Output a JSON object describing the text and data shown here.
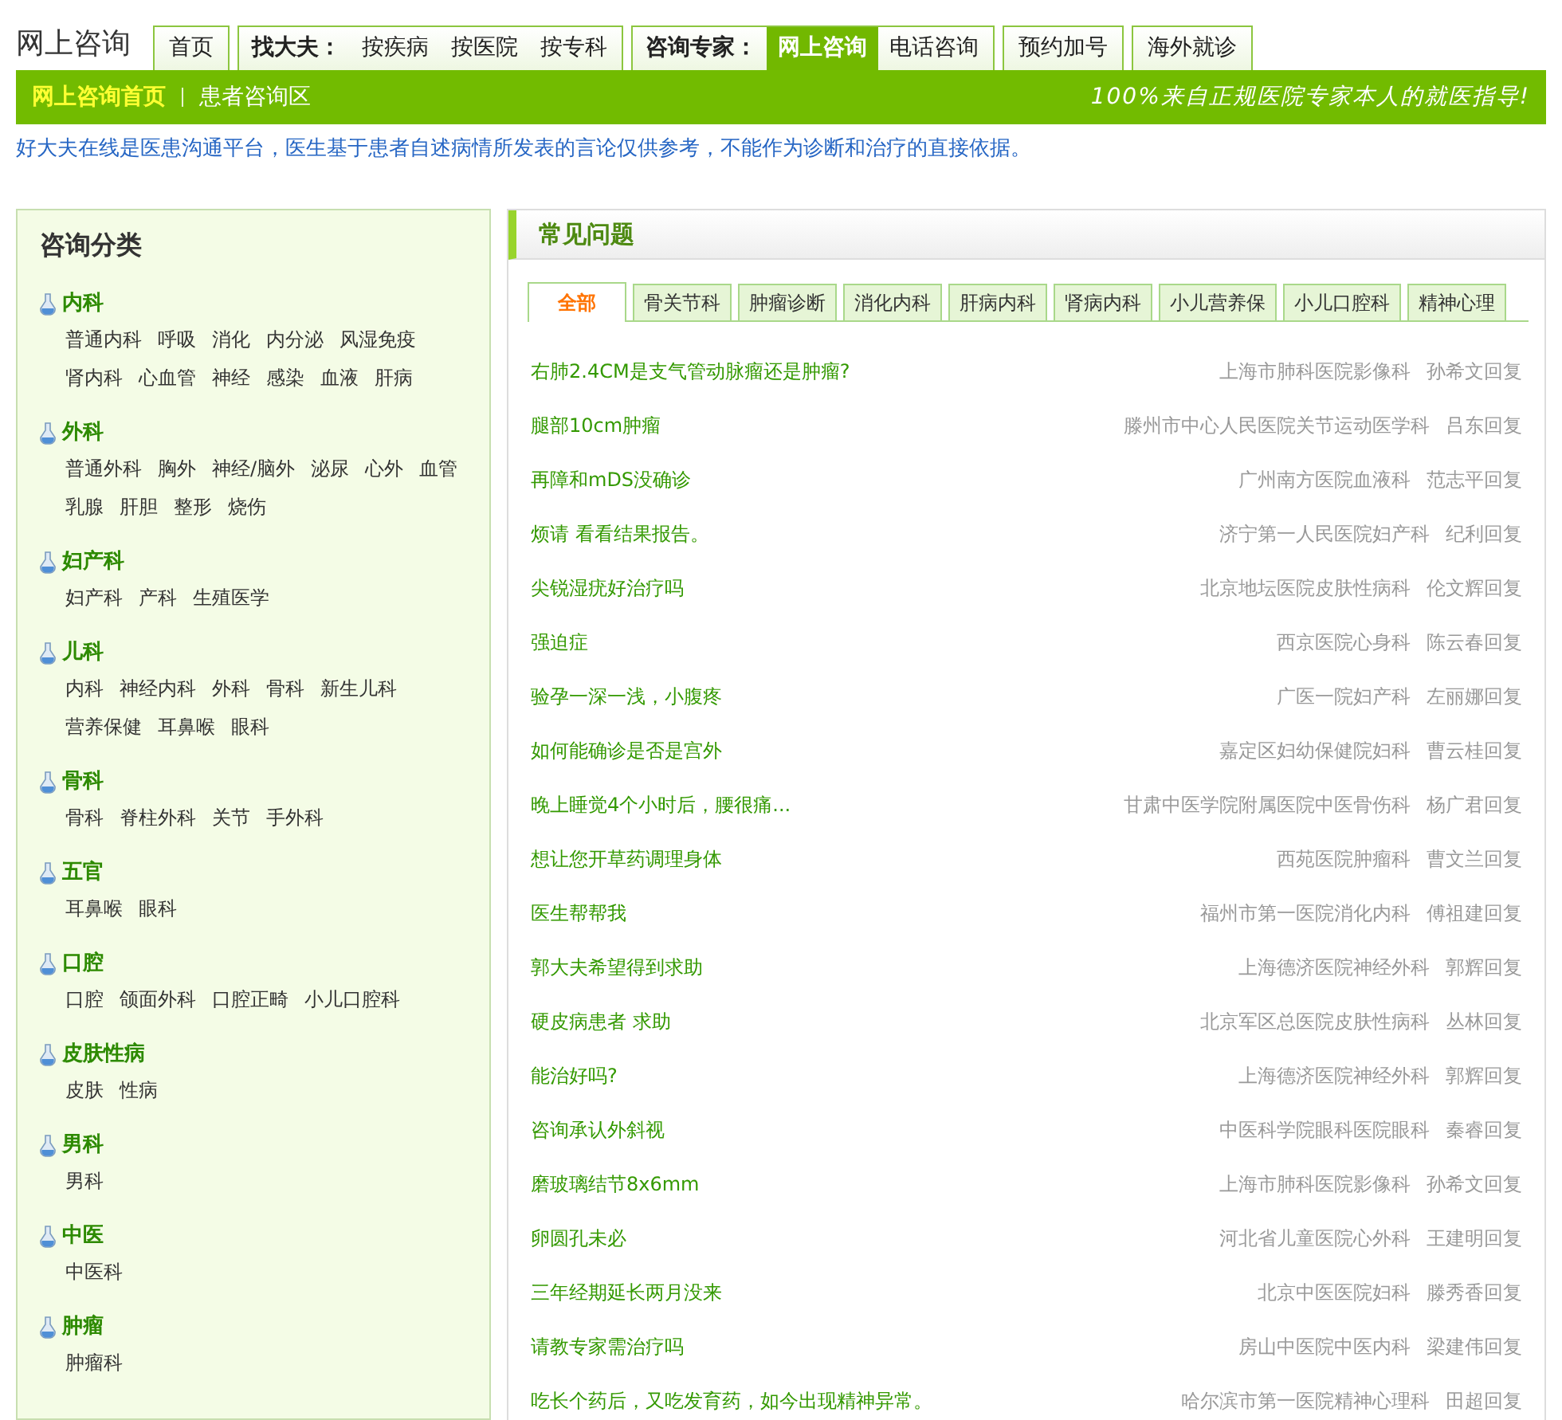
{
  "site_title": "网上咨询",
  "nav_groups": [
    {
      "items": [
        {
          "label": "首页",
          "selected": false
        }
      ]
    },
    {
      "label": "找大夫：",
      "items": [
        {
          "label": "按疾病",
          "selected": false
        },
        {
          "label": "按医院",
          "selected": false
        },
        {
          "label": "按专科",
          "selected": false
        }
      ]
    },
    {
      "label": "咨询专家：",
      "items": [
        {
          "label": "网上咨询",
          "selected": true
        },
        {
          "label": "电话咨询",
          "selected": false
        }
      ]
    },
    {
      "items": [
        {
          "label": "预约加号",
          "selected": false
        }
      ]
    },
    {
      "items": [
        {
          "label": "海外就诊",
          "selected": false
        }
      ]
    }
  ],
  "breadcrumb": [
    {
      "label": "网上咨询首页",
      "selected": true
    },
    {
      "label": "患者咨询区",
      "selected": false
    }
  ],
  "slogan": "100%来自正规医院专家本人的就医指导!",
  "disclaimer": "好大夫在线是医患沟通平台，医生基于患者自述病情所发表的言论仅供参考，不能作为诊断和治疗的直接依据。",
  "sidebar": {
    "title": "咨询分类",
    "categories": [
      {
        "name": "内科",
        "items": [
          "普通内科",
          "呼吸",
          "消化",
          "内分泌",
          "风湿免疫",
          "肾内科",
          "心血管",
          "神经",
          "感染",
          "血液",
          "肝病"
        ]
      },
      {
        "name": "外科",
        "items": [
          "普通外科",
          "胸外",
          "神经/脑外",
          "泌尿",
          "心外",
          "血管",
          "乳腺",
          "肝胆",
          "整形",
          "烧伤"
        ]
      },
      {
        "name": "妇产科",
        "items": [
          "妇产科",
          "产科",
          "生殖医学"
        ]
      },
      {
        "name": "儿科",
        "items": [
          "内科",
          "神经内科",
          "外科",
          "骨科",
          "新生儿科",
          "营养保健",
          "耳鼻喉",
          "眼科"
        ]
      },
      {
        "name": "骨科",
        "items": [
          "骨科",
          "脊柱外科",
          "关节",
          "手外科"
        ]
      },
      {
        "name": "五官",
        "items": [
          "耳鼻喉",
          "眼科"
        ]
      },
      {
        "name": "口腔",
        "items": [
          "口腔",
          "颌面外科",
          "口腔正畸",
          "小儿口腔科"
        ]
      },
      {
        "name": "皮肤性病",
        "items": [
          "皮肤",
          "性病"
        ]
      },
      {
        "name": "男科",
        "items": [
          "男科"
        ]
      },
      {
        "name": "中医",
        "items": [
          "中医科"
        ]
      },
      {
        "name": "肿瘤",
        "items": [
          "肿瘤科"
        ]
      }
    ]
  },
  "faq": {
    "title": "常见问题",
    "tabs": [
      {
        "label": "全部",
        "selected": true
      },
      {
        "label": "骨关节科",
        "selected": false
      },
      {
        "label": "肿瘤诊断",
        "selected": false
      },
      {
        "label": "消化内科",
        "selected": false
      },
      {
        "label": "肝病内科",
        "selected": false
      },
      {
        "label": "肾病内科",
        "selected": false
      },
      {
        "label": "小儿营养保",
        "selected": false
      },
      {
        "label": "小儿口腔科",
        "selected": false
      },
      {
        "label": "精神心理",
        "selected": false
      }
    ],
    "questions": [
      {
        "title": "右肺2.4CM是支气管动脉瘤还是肿瘤?",
        "source": "上海市肺科医院影像科",
        "reply": "孙希文回复"
      },
      {
        "title": "腿部10cm肿瘤",
        "source": "滕州市中心人民医院关节运动医学科",
        "reply": "吕东回复"
      },
      {
        "title": "再障和mDS没确诊",
        "source": "广州南方医院血液科",
        "reply": "范志平回复"
      },
      {
        "title": "烦请 看看结果报告。",
        "source": "济宁第一人民医院妇产科",
        "reply": "纪利回复"
      },
      {
        "title": "尖锐湿疣好治疗吗",
        "source": "北京地坛医院皮肤性病科",
        "reply": "伦文辉回复"
      },
      {
        "title": "强迫症",
        "source": "西京医院心身科",
        "reply": "陈云春回复"
      },
      {
        "title": "验孕一深一浅，小腹疼",
        "source": "广医一院妇产科",
        "reply": "左丽娜回复"
      },
      {
        "title": "如何能确诊是否是宫外",
        "source": "嘉定区妇幼保健院妇科",
        "reply": "曹云桂回复"
      },
      {
        "title": "晚上睡觉4个小时后，腰很痛...",
        "source": "甘肃中医学院附属医院中医骨伤科",
        "reply": "杨广君回复"
      },
      {
        "title": "想让您开草药调理身体",
        "source": "西苑医院肿瘤科",
        "reply": "曹文兰回复"
      },
      {
        "title": "医生帮帮我",
        "source": "福州市第一医院消化内科",
        "reply": "傅祖建回复"
      },
      {
        "title": "郭大夫希望得到求助",
        "source": "上海德济医院神经外科",
        "reply": "郭辉回复"
      },
      {
        "title": "硬皮病患者 求助",
        "source": "北京军区总医院皮肤性病科",
        "reply": "丛林回复"
      },
      {
        "title": "能治好吗?",
        "source": "上海德济医院神经外科",
        "reply": "郭辉回复"
      },
      {
        "title": "咨询承认外斜视",
        "source": "中医科学院眼科医院眼科",
        "reply": "秦睿回复"
      },
      {
        "title": "磨玻璃结节8x6mm",
        "source": "上海市肺科医院影像科",
        "reply": "孙希文回复"
      },
      {
        "title": "卵圆孔未必",
        "source": "河北省儿童医院心外科",
        "reply": "王建明回复"
      },
      {
        "title": "三年经期延长两月没来",
        "source": "北京中医医院妇科",
        "reply": "滕秀香回复"
      },
      {
        "title": "请教专家需治疗吗",
        "source": "房山中医院中医内科",
        "reply": "梁建伟回复"
      },
      {
        "title": "吃长个药后，又吃发育药，如今出现精神异常。",
        "source": "哈尔滨市第一医院精神心理科",
        "reply": "田超回复"
      }
    ]
  }
}
